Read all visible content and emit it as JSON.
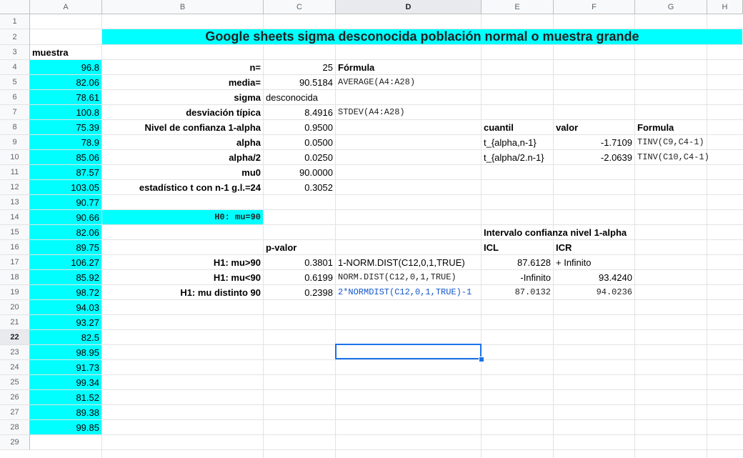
{
  "columns": [
    "A",
    "B",
    "C",
    "D",
    "E",
    "F",
    "G",
    "H"
  ],
  "rows": [
    "1",
    "2",
    "3",
    "4",
    "5",
    "6",
    "7",
    "8",
    "9",
    "10",
    "11",
    "12",
    "13",
    "14",
    "15",
    "16",
    "17",
    "18",
    "19",
    "20",
    "21",
    "22",
    "23",
    "24",
    "25",
    "26",
    "27",
    "28",
    "29"
  ],
  "title": "Google sheets sigma desconocida población normal o muestra grande",
  "sample_header": "muestra",
  "sample": [
    "96.8",
    "82.06",
    "78.61",
    "100.8",
    "75.39",
    "78.9",
    "85.06",
    "87.57",
    "103.05",
    "90.77",
    "90.66",
    "82.06",
    "89.75",
    "106.27",
    "85.92",
    "98.72",
    "94.03",
    "93.27",
    "82.5",
    "98.95",
    "91.73",
    "99.34",
    "81.52",
    "89.38",
    "99.85"
  ],
  "stats": {
    "n_label": "n=",
    "n_value": "25",
    "formula_header": "Fórmula",
    "media_label": "media=",
    "media_value": "90.5184",
    "media_formula": "AVERAGE(A4:A28)",
    "sigma_label": "sigma",
    "sigma_value": "desconocida",
    "sd_label": "desviación típica",
    "sd_value": "8.4916",
    "sd_formula": "STDEV(A4:A28)",
    "conf_label": "Nivel de confianza 1-alpha",
    "conf_value": "0.9500",
    "alpha_label": "alpha",
    "alpha_value": "0.0500",
    "alpha2_label": "alpha/2",
    "alpha2_value": "0.0250",
    "mu0_label": "mu0",
    "mu0_value": "90.0000",
    "t_label": "estadístico t con n-1 g.l.=24",
    "t_value": "0.3052"
  },
  "h0": "H0: mu=90",
  "quantiles": {
    "h_cuantil": "cuantil",
    "h_valor": "valor",
    "h_formula": "Formula",
    "q1_name": "t_{alpha,n-1}",
    "q1_value": "-1.7109",
    "q1_formula": "TINV(C9,C4-1)",
    "q2_name": "t_{alpha/2.n-1}",
    "q2_value": "-2.0639",
    "q2_formula": "TINV(C10,C4-1)"
  },
  "tests": {
    "pvalor_header": "p-valor",
    "h1a_label": "H1: mu>90",
    "h1a_value": "0.3801",
    "h1a_formula": "1-NORM.DIST(C12,0,1,TRUE)",
    "h1b_label": "H1: mu<90",
    "h1b_value": "0.6199",
    "h1b_formula": "NORM.DIST(C12,0,1,TRUE)",
    "h1c_label": "H1: mu distinto 90",
    "h1c_value": "0.2398",
    "h1c_formula": "2*NORMDIST(C12,0,1,TRUE)-1"
  },
  "interval": {
    "header": "Intervalo confianza nivel 1-alpha",
    "icl": "ICL",
    "icr": "ICR",
    "r17_icl": "87.6128",
    "r17_icr": "+ Infinito",
    "r18_icl": "-Infinito",
    "r18_icr": "93.4240",
    "r19_icl": "87.0132",
    "r19_icr": "94.0236"
  }
}
